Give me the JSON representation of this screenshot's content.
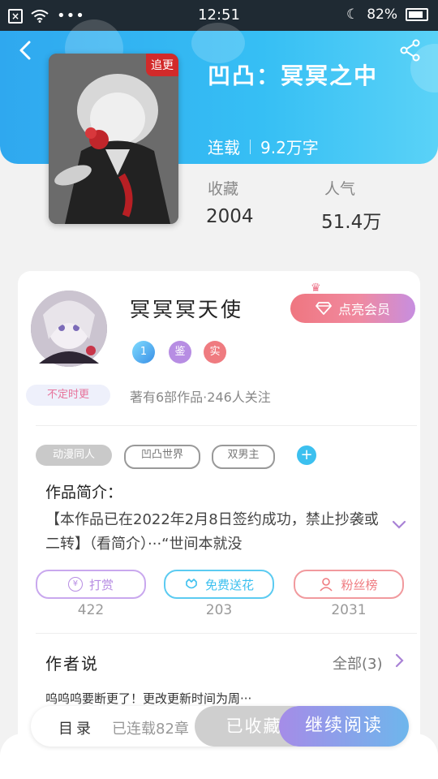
{
  "status_bar": {
    "time": "12:51",
    "battery": "82%",
    "icons": [
      "close-box-icon",
      "wifi-icon",
      "more-dots-icon",
      "moon-icon",
      "battery-icon"
    ]
  },
  "header": {
    "back_icon": "chevron-left-icon",
    "share_icon": "share-icon"
  },
  "book": {
    "cover_tag": "追更",
    "title": "凹凸：冥冥之中",
    "status": "连载",
    "word_count": "9.2万字"
  },
  "stats": {
    "collect_label": "收藏",
    "collect_value": "2004",
    "popularity_label": "人气",
    "popularity_value": "51.4万"
  },
  "author": {
    "name": "冥冥冥天使",
    "avatar_tag": "不定时更",
    "vip_button": "点亮会员",
    "badges": [
      "1",
      "鉴",
      "实"
    ],
    "stats_text": "著有6部作品·246人关注"
  },
  "tags": [
    "动漫同人",
    "凹凸世界",
    "双男主"
  ],
  "intro": {
    "title": "作品简介：",
    "text": "【本作品已在2022年2月8日签约成功，禁止抄袭或二转】（看简介）···“世间本就没"
  },
  "actions": [
    {
      "label": "打赏",
      "count": "422",
      "color": "#b78de3"
    },
    {
      "label": "免费送花",
      "count": "203",
      "color": "#3cc0ef"
    },
    {
      "label": "粉丝榜",
      "count": "2031",
      "color": "#ef7b80"
    }
  ],
  "author_says": {
    "title": "作者说",
    "all_label": "全部(3)",
    "text": "呜呜呜要断更了！更改更新时间为周···"
  },
  "bottom_bar": {
    "toc_label": "目录",
    "toc_status": "已连载82章",
    "collected_label": "已收藏",
    "read_label": "继续阅读"
  }
}
